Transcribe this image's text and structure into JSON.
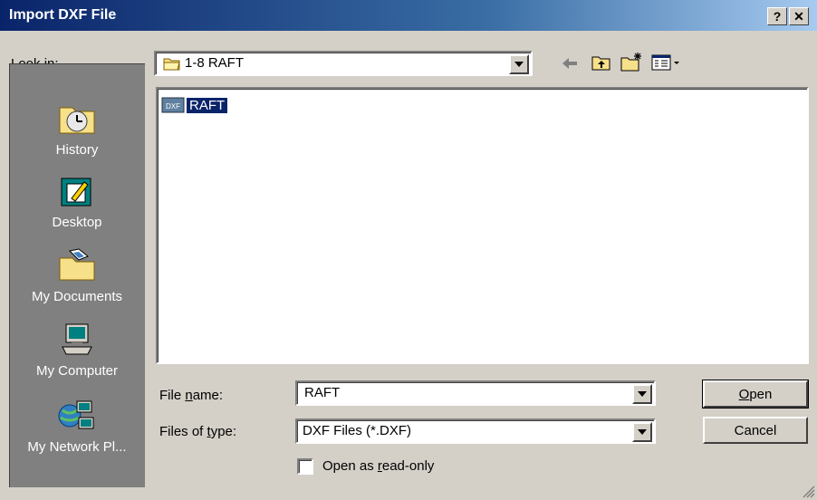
{
  "window": {
    "title": "Import DXF File",
    "help_label": "?",
    "close_label": "✕"
  },
  "lookin": {
    "label_prefix": "Look ",
    "label_accel": "i",
    "label_suffix": "n:",
    "value": "1-8 RAFT"
  },
  "toolbar": {
    "back_icon": "back-arrow-icon",
    "up_icon": "up-folder-icon",
    "new_folder_icon": "new-folder-icon",
    "views_icon": "views-menu-icon"
  },
  "places": [
    {
      "label": "History",
      "icon": "history-icon"
    },
    {
      "label": "Desktop",
      "icon": "desktop-icon"
    },
    {
      "label": "My Documents",
      "icon": "my-documents-icon"
    },
    {
      "label": "My Computer",
      "icon": "my-computer-icon"
    },
    {
      "label": "My Network Pl...",
      "icon": "network-places-icon"
    }
  ],
  "files": [
    {
      "name": "RAFT",
      "icon_text": "DXF",
      "selected": true
    }
  ],
  "filename": {
    "label_prefix": "File ",
    "label_accel": "n",
    "label_suffix": "ame:",
    "value": "RAFT"
  },
  "filetype": {
    "label_prefix": "Files of ",
    "label_accel": "t",
    "label_suffix": "ype:",
    "value": "DXF Files (*.DXF)"
  },
  "readonly": {
    "label_prefix": "Open as ",
    "label_accel": "r",
    "label_suffix": "ead-only",
    "checked": false
  },
  "buttons": {
    "open_accel": "O",
    "open_rest": "pen",
    "cancel": "Cancel"
  }
}
